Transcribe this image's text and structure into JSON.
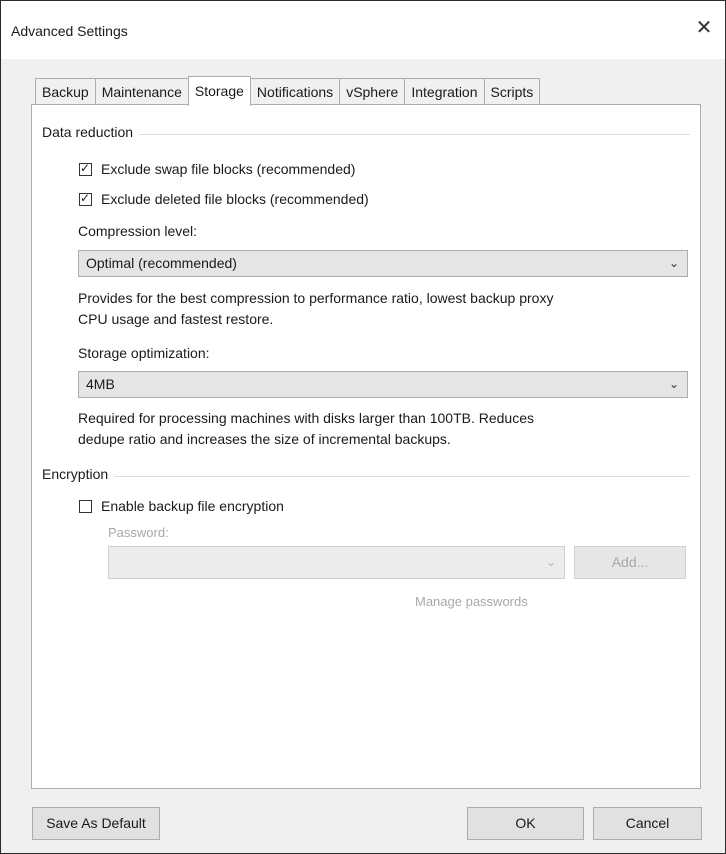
{
  "window": {
    "title": "Advanced Settings",
    "close_glyph": "✕"
  },
  "tabs": [
    {
      "label": "Backup"
    },
    {
      "label": "Maintenance"
    },
    {
      "label": "Storage",
      "active": true
    },
    {
      "label": "Notifications"
    },
    {
      "label": "vSphere"
    },
    {
      "label": "Integration"
    },
    {
      "label": "Scripts"
    }
  ],
  "data_reduction": {
    "group_label": "Data reduction",
    "exclude_swap": {
      "label": "Exclude swap file blocks (recommended)",
      "checked": true
    },
    "exclude_deleted": {
      "label": "Exclude deleted file blocks (recommended)",
      "checked": true
    },
    "compression_label": "Compression level:",
    "compression_value": "Optimal (recommended)",
    "compression_desc_1": "Provides for the best compression to performance ratio, lowest backup proxy",
    "compression_desc_2": "CPU usage and fastest restore.",
    "storage_opt_label": "Storage optimization:",
    "storage_opt_value": "4MB",
    "storage_opt_desc_1": "Required for processing machines with disks larger than 100TB. Reduces",
    "storage_opt_desc_2": "dedupe ratio and increases the size of incremental backups."
  },
  "encryption": {
    "group_label": "Encryption",
    "enable": {
      "label": "Enable backup file encryption",
      "checked": false
    },
    "password_label": "Password:",
    "password_value": "",
    "add_button": "Add...",
    "manage_link": "Manage passwords"
  },
  "footer": {
    "save_default": "Save As Default",
    "ok": "OK",
    "cancel": "Cancel"
  },
  "icons": {
    "check": "✓",
    "chevron": "⌄"
  }
}
